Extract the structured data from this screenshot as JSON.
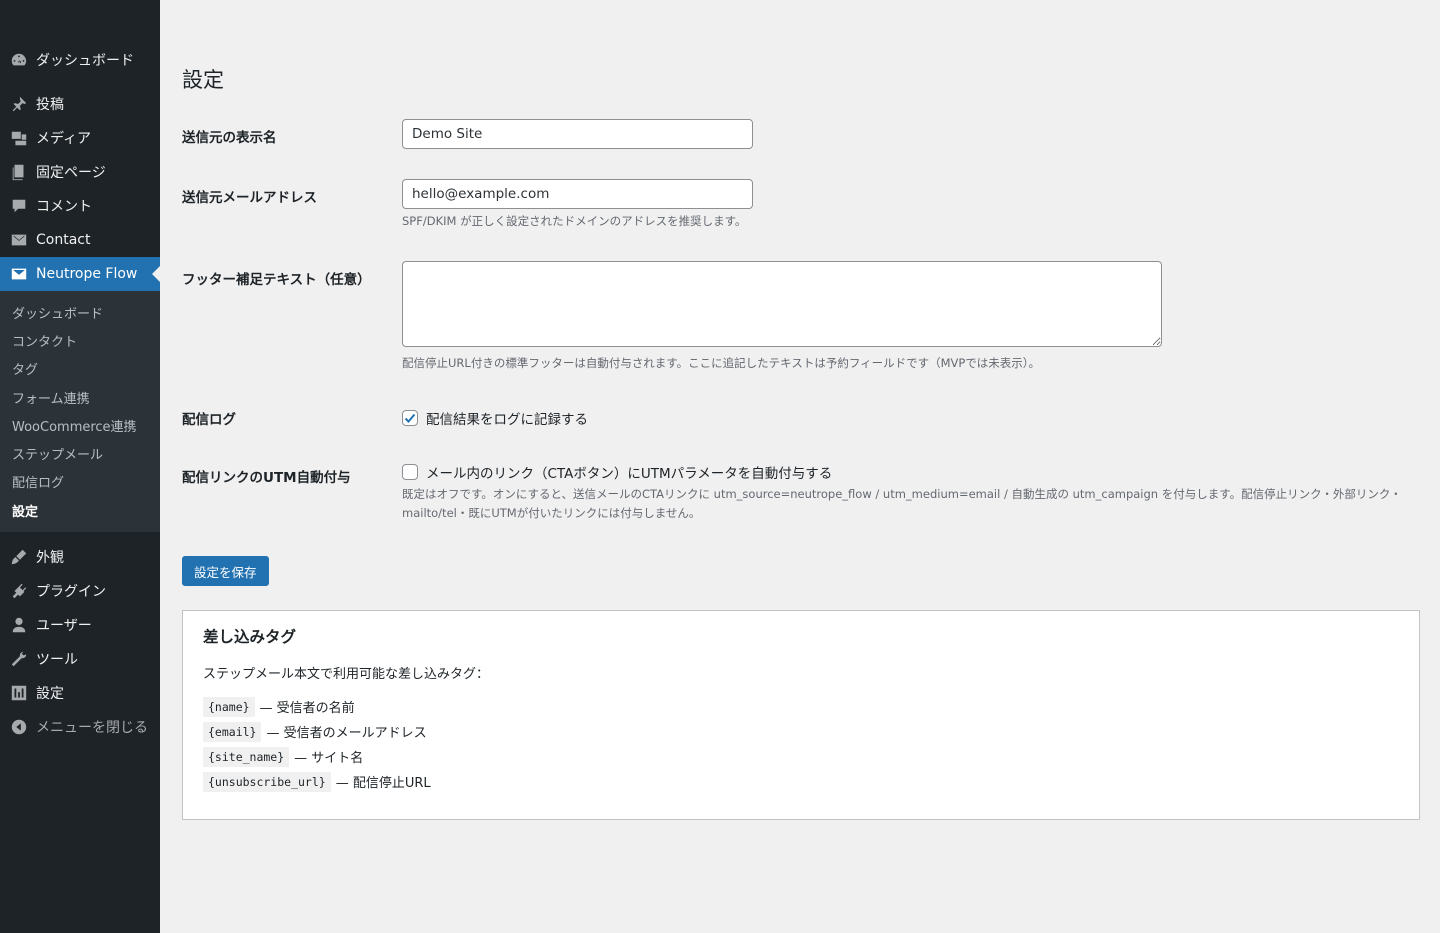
{
  "sidebar": {
    "items_top": [
      {
        "label": "ダッシュボード",
        "icon": "dashboard-icon"
      },
      {
        "label": "投稿",
        "icon": "pin-icon"
      },
      {
        "label": "メディア",
        "icon": "media-icon"
      },
      {
        "label": "固定ページ",
        "icon": "page-icon"
      },
      {
        "label": "コメント",
        "icon": "comment-icon"
      },
      {
        "label": "Contact",
        "icon": "mail-icon"
      },
      {
        "label": "Neutrope Flow",
        "icon": "mail-icon"
      }
    ],
    "submenu": [
      "ダッシュボード",
      "コンタクト",
      "タグ",
      "フォーム連携",
      "WooCommerce連携",
      "ステップメール",
      "配信ログ",
      "設定"
    ],
    "items_bottom": [
      {
        "label": "外観",
        "icon": "appearance-icon"
      },
      {
        "label": "プラグイン",
        "icon": "plugin-icon"
      },
      {
        "label": "ユーザー",
        "icon": "user-icon"
      },
      {
        "label": "ツール",
        "icon": "tool-icon"
      },
      {
        "label": "設定",
        "icon": "settings-icon"
      },
      {
        "label": "メニューを閉じる",
        "icon": "collapse-icon"
      }
    ]
  },
  "page": {
    "title": "設定",
    "fields": {
      "from_name": {
        "label": "送信元の表示名",
        "value": "Demo Site"
      },
      "from_email": {
        "label": "送信元メールアドレス",
        "value": "hello@example.com",
        "desc": "SPF/DKIM が正しく設定されたドメインのアドレスを推奨します。"
      },
      "footer": {
        "label": "フッター補足テキスト（任意）",
        "value": "",
        "desc": "配信停止URL付きの標準フッターは自動付与されます。ここに追記したテキストは予約フィールドです（MVPでは未表示）。"
      },
      "log": {
        "label": "配信ログ",
        "checkbox_label": "配信結果をログに記録する",
        "checked": true
      },
      "utm": {
        "label": "配信リンクのUTM自動付与",
        "checkbox_label": "メール内のリンク（CTAボタン）にUTMパラメータを自動付与する",
        "checked": false,
        "desc": "既定はオフです。オンにすると、送信メールのCTAリンクに utm_source=neutrope_flow / utm_medium=email / 自動生成の utm_campaign を付与します。配信停止リンク・外部リンク・mailto/tel・既にUTMが付いたリンクには付与しません。"
      }
    },
    "save_label": "設定を保存"
  },
  "tags_card": {
    "title": "差し込みタグ",
    "intro": "ステップメール本文で利用可能な差し込みタグ：",
    "tags": [
      {
        "code": "{name}",
        "desc": "— 受信者の名前"
      },
      {
        "code": "{email}",
        "desc": "— 受信者のメールアドレス"
      },
      {
        "code": "{site_name}",
        "desc": "— サイト名"
      },
      {
        "code": "{unsubscribe_url}",
        "desc": "— 配信停止URL"
      }
    ]
  },
  "colors": {
    "sidebar_bg": "#1d2327",
    "accent": "#2271b1",
    "page_bg": "#f0f0f1"
  }
}
